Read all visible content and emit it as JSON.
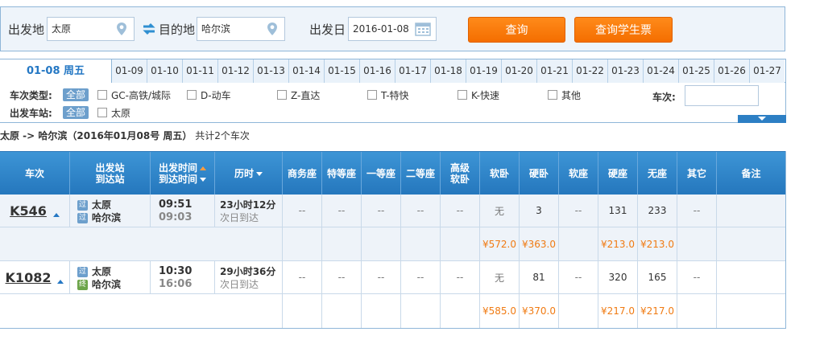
{
  "search": {
    "from_label": "出发地",
    "from_value": "太原",
    "to_label": "目的地",
    "to_value": "哈尔滨",
    "date_label": "出发日",
    "date_value": "2016-01-08",
    "query_button": "查询",
    "student_button": "查询学生票"
  },
  "date_tabs": {
    "active": "01-08 周五",
    "items": [
      "01-09",
      "01-10",
      "01-11",
      "01-12",
      "01-13",
      "01-14",
      "01-15",
      "01-16",
      "01-17",
      "01-18",
      "01-19",
      "01-20",
      "01-21",
      "01-22",
      "01-23",
      "01-24",
      "01-25",
      "01-26",
      "01-27"
    ]
  },
  "filters": {
    "train_type_label": "车次类型:",
    "all_badge": "全部",
    "train_types": [
      "GC-高铁/城际",
      "D-动车",
      "Z-直达",
      "T-特快",
      "K-快速",
      "其他"
    ],
    "station_label": "出发车站:",
    "stations": [
      "太原"
    ],
    "train_no_label": "车次:"
  },
  "summary": {
    "route": "太原 -> 哈尔滨（2016年01月08号  周五）",
    "count": "共计2个车次"
  },
  "table": {
    "headers": {
      "train": "车次",
      "station_from": "出发站",
      "station_to": "到达站",
      "time_depart": "出发时间",
      "time_arrive": "到达时间",
      "duration": "历时",
      "business": "商务座",
      "special": "特等座",
      "first": "一等座",
      "second": "二等座",
      "hs1": "高级",
      "hs2": "软卧",
      "soft_sleeper": "软卧",
      "hard_sleeper": "硬卧",
      "soft_seat": "软座",
      "hard_seat": "硬座",
      "no_seat": "无座",
      "other": "其它",
      "remark": "备注"
    },
    "rows": [
      {
        "train": "K546",
        "from_station": "太原",
        "to_station": "哈尔滨",
        "from_icon": "过",
        "to_icon": "过",
        "depart": "09:51",
        "arrive": "09:03",
        "duration": "23小时12分",
        "arrive_note": "次日到达",
        "seats": [
          "--",
          "--",
          "--",
          "--",
          "--",
          "无",
          "3",
          "--",
          "131",
          "233",
          "--",
          ""
        ],
        "prices": [
          "",
          "",
          "",
          "",
          "",
          "¥572.0",
          "¥363.0",
          "",
          "¥213.0",
          "¥213.0",
          "",
          ""
        ]
      },
      {
        "train": "K1082",
        "from_station": "太原",
        "to_station": "哈尔滨",
        "from_icon": "过",
        "to_icon": "终",
        "depart": "10:30",
        "arrive": "16:06",
        "duration": "29小时36分",
        "arrive_note": "次日到达",
        "seats": [
          "--",
          "--",
          "--",
          "--",
          "--",
          "无",
          "81",
          "--",
          "320",
          "165",
          "--",
          ""
        ],
        "prices": [
          "",
          "",
          "",
          "",
          "",
          "¥585.0",
          "¥370.0",
          "",
          "¥217.0",
          "¥217.0",
          "",
          ""
        ]
      }
    ]
  }
}
